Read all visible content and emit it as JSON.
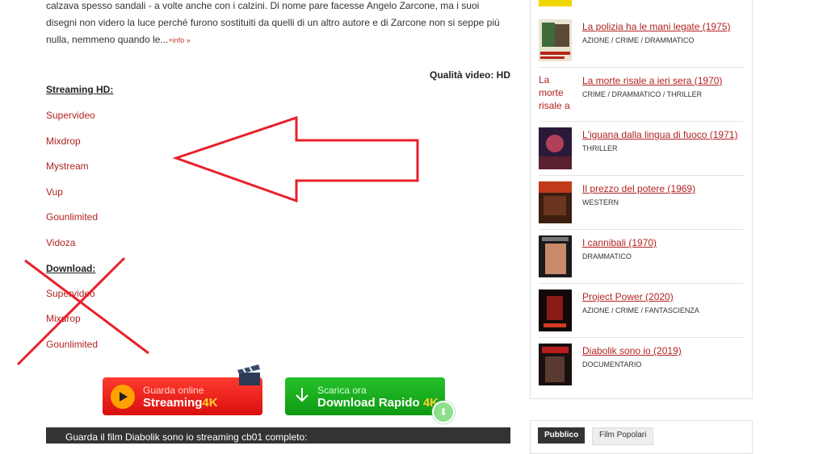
{
  "description": {
    "text": "calzava spesso sandali - a volte anche con i calzini. Di nome pare facesse Angelo Zarcone, ma i suoi disegni non videro la luce perché furono sostituiti da quelli di un altro autore e di Zarcone non si seppe più nulla, nemmeno quando le...",
    "more": "+info »"
  },
  "quality_label": "Qualità video: HD",
  "streaming": {
    "heading": "Streaming HD:",
    "links": [
      "Supervideo",
      "Mixdrop",
      "Mystream",
      "Vup",
      "Gounlimited",
      "Vidoza"
    ]
  },
  "download": {
    "heading": "Download:",
    "links": [
      "Supervideo",
      "Mixdrop",
      "Gounlimited"
    ]
  },
  "buttons": {
    "stream": {
      "small": "Guarda online",
      "big": "Streaming",
      "k": "4K"
    },
    "download": {
      "small": "Scarica ora",
      "big": "Download Rapido",
      "k": "4K"
    }
  },
  "darkbar_text": "Guarda il film Diabolik sono io streaming cb01 completo:",
  "sidebar": {
    "items": [
      {
        "title": "La polizia ha le mani legate (1975)",
        "genre": "AZIONE / CRIME / DRAMMATICO"
      },
      {
        "title": "La morte risale a ieri sera (1970)",
        "genre": "CRIME / DRAMMATICO / THRILLER",
        "alt": "La morte risale a"
      },
      {
        "title": "L'iguana dalla lingua di fuoco (1971)",
        "genre": "THRILLER"
      },
      {
        "title": "Il prezzo del potere (1969)",
        "genre": "WESTERN"
      },
      {
        "title": "I cannibali (1970)",
        "genre": "DRAMMATICO"
      },
      {
        "title": "Project Power (2020)",
        "genre": "AZIONE / CRIME / FANTASCIENZA"
      },
      {
        "title": "Diabolik sono io (2019)",
        "genre": "DOCUMENTARIO"
      }
    ],
    "tabs": [
      "Pubblico",
      "Film Popolari"
    ]
  },
  "colors": {
    "link": "#b22222",
    "annotation": "#e8202a",
    "stream_button": "#e81b14",
    "download_button": "#18b21f"
  }
}
